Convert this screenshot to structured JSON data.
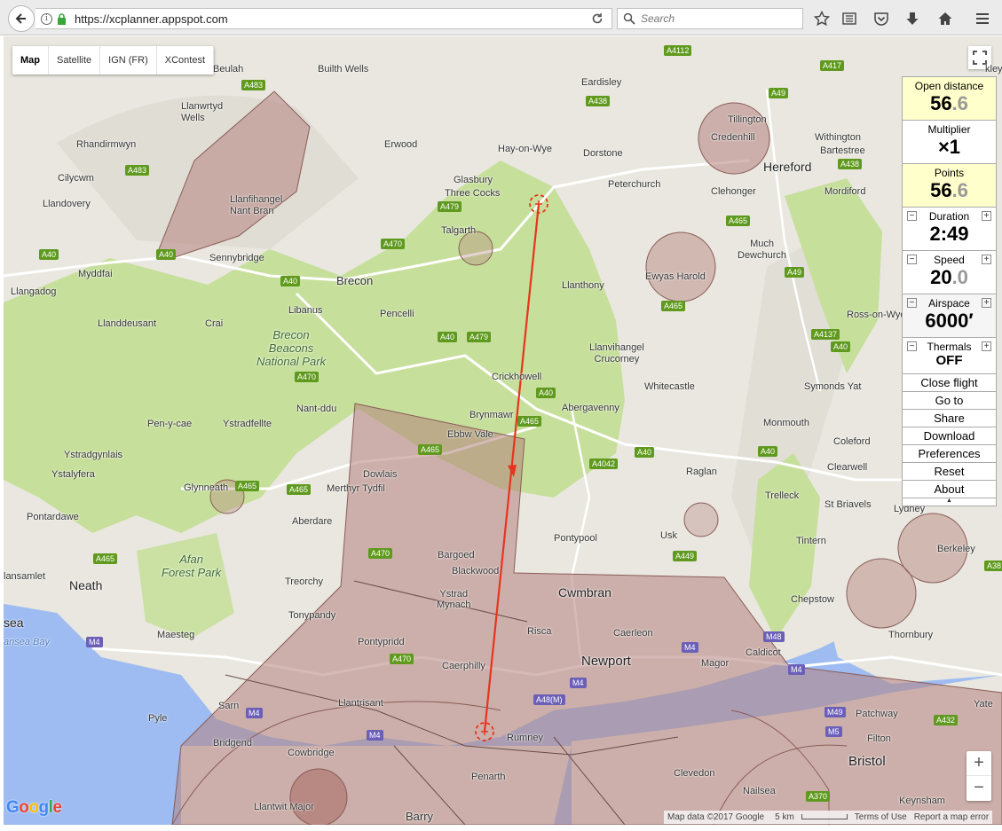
{
  "browser": {
    "url": "https://xcplanner.appspot.com",
    "search_placeholder": "Search"
  },
  "map_types": [
    "Map",
    "Satellite",
    "IGN (FR)",
    "XContest"
  ],
  "places": {
    "beulah": "Beulah",
    "builth_wells": "Builth Wells",
    "llanwrtyd_wells": "Llanwrtyd\nWells",
    "rhandirmwyn": "Rhandirmwyn",
    "cilycwm": "Cilycwm",
    "llandovery": "Llandovery",
    "myddfai": "Myddfai",
    "llangadog": "Llangadog",
    "llanddeusant": "Llanddeusant",
    "llanfihangel": "Llanfihangel\nNant Bran",
    "sennybridge": "Sennybridge",
    "brecon": "Brecon",
    "libanus": "Libanus",
    "crai": "Crai",
    "pencelli": "Pencelli",
    "erwood": "Erwood",
    "glasbury": "Glasbury",
    "three_cocks": "Three Cocks",
    "talgarth": "Talgarth",
    "hay_on_wye": "Hay-on-Wye",
    "eardisley": "Eardisley",
    "dorstone": "Dorstone",
    "peterchurch": "Peterchurch",
    "clehonger": "Clehonger",
    "hereford": "Hereford",
    "tillington": "Tillington",
    "credenhill": "Credenhill",
    "withington": "Withington",
    "bartestree": "Bartestree",
    "mordiford": "Mordiford",
    "much_dewchurch": "Much\nDewchurch",
    "ewyas_harold": "Ewyas Harold",
    "llanthony": "Llanthony",
    "llanvihangel": "Llanvihangel\nCrucorney",
    "ross_on_wye": "Ross-on-Wye",
    "whitecastle": "Whitecastle",
    "symonds_yat": "Symonds Yat",
    "crickhowell": "Crickhowell",
    "abergavenny": "Abergavenny",
    "monmouth": "Monmouth",
    "coleford": "Coleford",
    "raglan": "Raglan",
    "clearwell": "Clearwell",
    "trelleck": "Trelleck",
    "st_briavels": "St Briavels",
    "lydney": "Lydney",
    "tintern": "Tintern",
    "berkeley": "Berkeley",
    "chepstow": "Chepstow",
    "thornbury": "Thornbury",
    "usk": "Usk",
    "pontypool": "Pontypool",
    "brynmawr": "Brynmawr",
    "ebbw_vale": "Ebbw Vale",
    "dowlais": "Dowlais",
    "merthyr": "Merthyr Tydfil",
    "nant_ddu": "Nant-ddu",
    "pen_y_cae": "Pen-y-cae",
    "ystradfellte": "Ystradfellte",
    "ystradgynlais": "Ystradgynlais",
    "ystalyfera": "Ystalyfera",
    "glynneath": "Glynneath",
    "aberdare": "Aberdare",
    "pontardawe": "Pontardawe",
    "bargoed": "Bargoed",
    "blackwood": "Blackwood",
    "cwmbran": "Cwmbran",
    "ystrad_mynach": "Ystrad\nMynach",
    "treorchy": "Treorchy",
    "tonypandy": "Tonypandy",
    "neath": "Neath",
    "lansamlet": "lansamlet",
    "sea": "sea",
    "maesteg": "Maesteg",
    "pontypridd": "Pontypridd",
    "risca": "Risca",
    "caerleon": "Caerleon",
    "caldicot": "Caldicot",
    "newport": "Newport",
    "magor": "Magor",
    "caerphilly": "Caerphilly",
    "llantrisant": "Llantrisant",
    "sarn": "Sarn",
    "pyle": "Pyle",
    "bridgend": "Bridgend",
    "cowbridge": "Cowbridge",
    "rumney": "Rumney",
    "penarth": "Penarth",
    "llantwit_major": "Llantwit Major",
    "barry": "Barry",
    "clevedon": "Clevedon",
    "nailsea": "Nailsea",
    "bristol": "Bristol",
    "keynsham": "Keynsham",
    "filton": "Filton",
    "patchway": "Patchway",
    "yate": "Yate",
    "swansea_bay": "ansea Bay",
    "brecon_beacons": "Brecon\nBeacons\nNational Park",
    "afan_forest": "Afan\nForest Park",
    "kley": "kley"
  },
  "roads": {
    "a483": "A483",
    "a470": "A470",
    "a40": "A40",
    "a479": "A479",
    "a438": "A438",
    "a4112": "A4112",
    "a417": "A417",
    "a49": "A49",
    "a465": "A465",
    "a4137": "A4137",
    "a4042": "A4042",
    "a449": "A449",
    "a38": "A38",
    "m4": "M4",
    "m48": "M48",
    "a48m": "A48(M)",
    "m49": "M49",
    "m5": "M5",
    "a432": "A432",
    "a370": "A370"
  },
  "panel": {
    "open_distance": {
      "label": "Open distance",
      "int": "56",
      "dec": ".6"
    },
    "multiplier": {
      "label": "Multiplier",
      "value": "×1"
    },
    "points": {
      "label": "Points",
      "int": "56",
      "dec": ".6"
    },
    "duration": {
      "label": "Duration",
      "value": "2:49"
    },
    "speed": {
      "label": "Speed",
      "int": "20",
      "dec": ".0"
    },
    "airspace": {
      "label": "Airspace",
      "value": "6000′"
    },
    "thermals": {
      "label": "Thermals",
      "value": "OFF"
    },
    "buttons": [
      "Close flight",
      "Go to",
      "Share",
      "Download",
      "Preferences",
      "Reset",
      "About"
    ],
    "minus": "−",
    "plus": "+",
    "caret": "▲"
  },
  "map_controls": {
    "zoom_in": "+",
    "zoom_out": "−",
    "google": "Google"
  },
  "attribution": {
    "data": "Map data ©2017 Google",
    "scale": "5 km",
    "terms": "Terms of Use",
    "report": "Report a map error"
  },
  "colors": {
    "park_green": "#c6df9a",
    "airspace": "#b4817d",
    "water": "#9ebcf1",
    "route": "#e8341e"
  }
}
